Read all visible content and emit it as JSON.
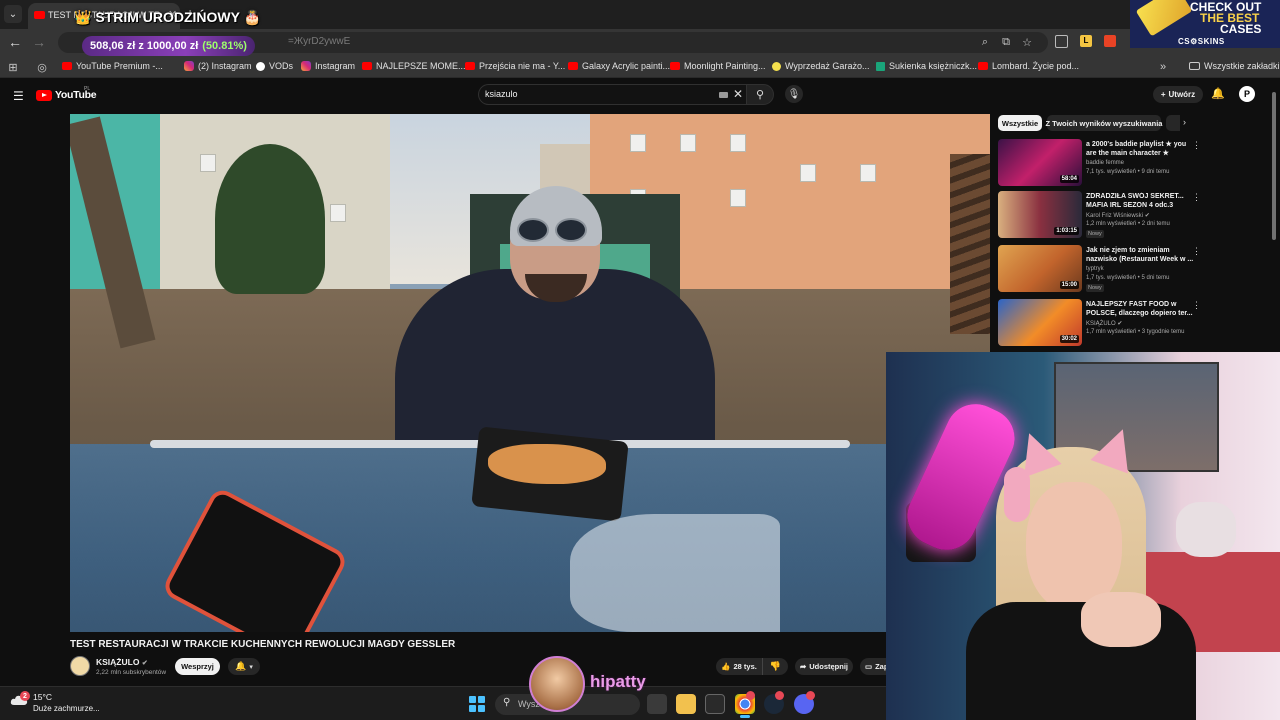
{
  "browser": {
    "tab_title": "TEST RESTAURACJI W TRAKCIE",
    "tab_close": "✕",
    "new_tab": "+",
    "address_ghost": "=ЖyrD2ywwE",
    "overlay_banner": "👑 STRIM URODZIŃOWY 🎂",
    "goal": {
      "amount": "508,06 zł z 1000,00 zł",
      "percent": "(50.81%)"
    },
    "bookmarks": [
      {
        "label": "YouTube Premium -...",
        "icon": "youtube-icon"
      },
      {
        "label": "(2) Instagram",
        "icon": "instagram-icon"
      },
      {
        "label": "VODs",
        "icon": "vods-icon"
      },
      {
        "label": "Instagram",
        "icon": "instagram-icon"
      },
      {
        "label": "NAJLEPSZE MOME...",
        "icon": "youtube-icon"
      },
      {
        "label": "Przejścia nie ma - Y...",
        "icon": "youtube-icon"
      },
      {
        "label": "Galaxy Acrylic painti...",
        "icon": "youtube-icon"
      },
      {
        "label": "Moonlight Painting...",
        "icon": "youtube-icon"
      },
      {
        "label": "Wyprzedaż Garażo...",
        "icon": "shop-icon"
      },
      {
        "label": "Sukienka księżniczk...",
        "icon": "vinted-icon"
      },
      {
        "label": "Lombard. Życie pod...",
        "icon": "youtube-icon"
      }
    ],
    "all_bookmarks": "Wszystkie zakładki"
  },
  "promo": {
    "line1": "CHECK OUT",
    "line2": "THE BEST",
    "line3": "CASES",
    "brand": "CS⚙SKINS"
  },
  "youtube": {
    "logo": "YouTube",
    "region": "PL",
    "search_value": "ksiazulo",
    "create_label": "Utwórz",
    "account_initial": "P",
    "video": {
      "title": "TEST RESTAURACJI W TRAKCIE KUCHENNYCH REWOLUCJI MAGDY GESSLER",
      "channel": "KSIĄŻULO",
      "subscribers": "2,22 mln subskrybentów",
      "support_label": "Wesprzyj",
      "likes": "28 tys.",
      "share_label": "Udostępnij",
      "save_label": "Zapisz"
    },
    "chips": [
      "Wszystkie",
      "Z Twoich wyników wyszukiwania"
    ],
    "recommendations": [
      {
        "title": "a 2000's baddie playlist ★ you are the main character ★",
        "channel": "baddie femme",
        "meta": "7,1 tys. wyświetleń • 9 dni temu",
        "duration": "58:04",
        "badge": ""
      },
      {
        "title": "ZDRADZIŁA SWÓJ SEKRET... MAFIA IRL SEZON 4 odc.3",
        "channel": "Karol Friz Wiśniewski",
        "meta": "1,2 mln wyświetleń • 2 dni temu",
        "duration": "1:03:15",
        "badge": "Nowy"
      },
      {
        "title": "Jak nie zjem to zmieniam nazwisko (Restaurant Week w ...",
        "channel": "typtryk",
        "meta": "1,7 tys. wyświetleń • 5 dni temu",
        "duration": "15:00",
        "badge": "Nowy"
      },
      {
        "title": "NAJLEPSZY FAST FOOD w POLSCE, dlaczego dopiero ter...",
        "channel": "KSIĄŻULO",
        "meta": "1,7 mln wyświetleń • 3 tygodnie temu",
        "duration": "30:02",
        "badge": ""
      }
    ]
  },
  "stream": {
    "streamer": "hipatty"
  },
  "taskbar": {
    "weather_badge": "2",
    "temperature": "15°C",
    "condition": "Duże zachmurze...",
    "search_placeholder": "Wyszukaj"
  }
}
